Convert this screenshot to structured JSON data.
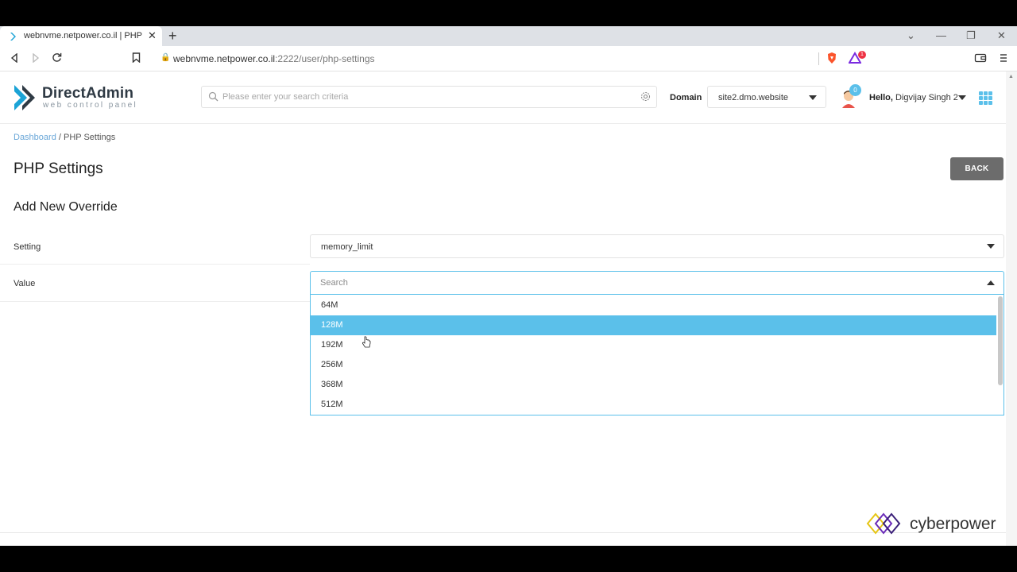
{
  "browser": {
    "tab_title": "webnvme.netpower.co.il | PHP Se",
    "tab_close": "✕",
    "new_tab": "+",
    "url_prefix": "webnvme.netpower.co.il",
    "url_path": ":2222/user/php-settings",
    "window_controls": [
      "⌄",
      "—",
      "❐",
      "✕"
    ]
  },
  "header": {
    "logo_title": "DirectAdmin",
    "logo_subtitle": "web control panel",
    "search_placeholder": "Please enter your search criteria",
    "domain_label": "Domain",
    "domain_value": "site2.dmo.website",
    "notification_count": "0",
    "hello_prefix": "Hello,",
    "user_name": "Digvijay Singh 2"
  },
  "breadcrumb": {
    "home": "Dashboard",
    "separator": " / ",
    "current": "PHP Settings"
  },
  "page": {
    "title": "PHP Settings",
    "back_label": "BACK",
    "section_title": "Add New Override"
  },
  "form": {
    "setting_label": "Setting",
    "setting_value": "memory_limit",
    "value_label": "Value",
    "value_search_placeholder": "Search",
    "options": [
      "64M",
      "128M",
      "192M",
      "256M",
      "368M",
      "512M"
    ],
    "highlighted_option": "128M"
  },
  "footer": {
    "brand": "cyberpower"
  },
  "colors": {
    "accent": "#5bc0ea",
    "back_button": "#6c6c6c",
    "link": "#6aa7d8"
  }
}
